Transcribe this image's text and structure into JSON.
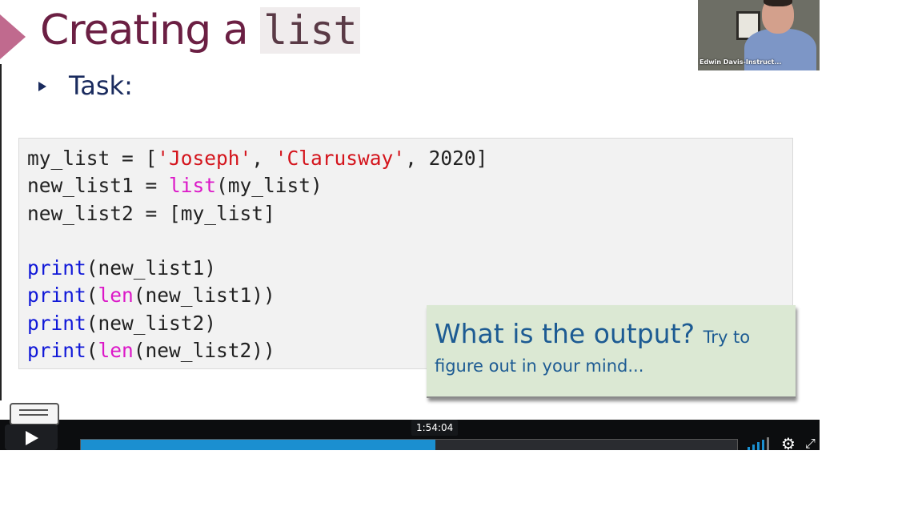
{
  "slide": {
    "title_text": "Creating a",
    "title_code": "list",
    "bullet": "Task:"
  },
  "code_lines": [
    "my_list = ['Joseph', 'Clarusway', 2020]",
    "new_list1 = list(my_list)",
    "new_list2 = [my_list]",
    "",
    "print(new_list1)",
    "print(len(new_list1))",
    "print(new_list2)",
    "print(len(new_list2))"
  ],
  "callout": {
    "question": "What is the output?",
    "hint_start": "Try to",
    "hint_end": "figure out in your mind..."
  },
  "webcam": {
    "name_label": "Edwin Davis-Instruct..."
  },
  "player": {
    "hover_time": "1:54:04",
    "progress": 0.54,
    "accent": "#1b8fd0"
  },
  "icons": [
    "play-icon",
    "volume-icon",
    "settings-gear-icon",
    "fullscreen-icon",
    "notes-logo-icon"
  ]
}
